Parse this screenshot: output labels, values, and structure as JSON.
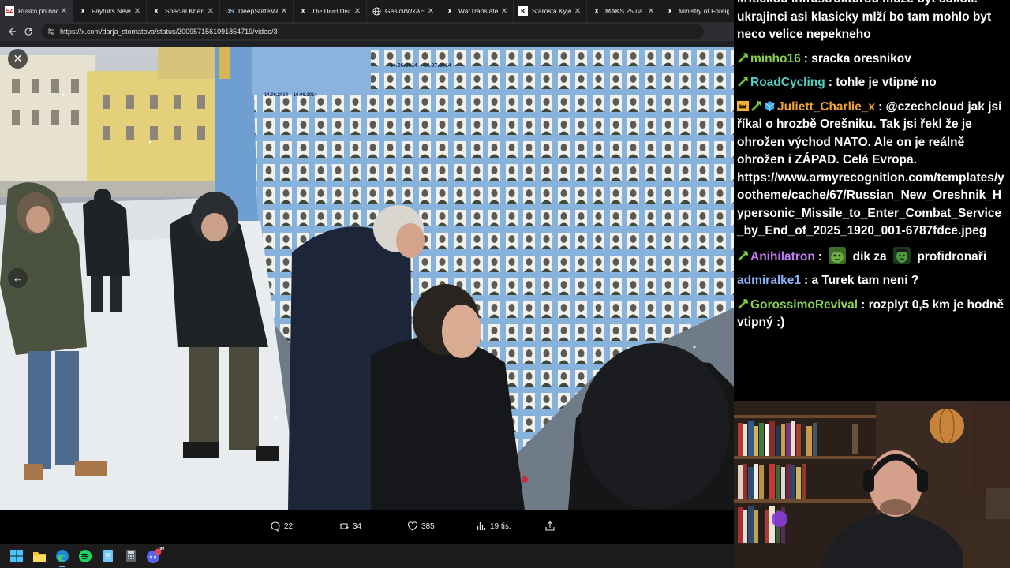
{
  "tabs": [
    {
      "label": "Rusko při noční",
      "favicon": "SZ"
    },
    {
      "label": "Faytuks News",
      "favicon": "X"
    },
    {
      "label": "Special Kherson",
      "favicon": "X"
    },
    {
      "label": "DeepStateMAP",
      "favicon": "DS"
    },
    {
      "label": "The Dead District",
      "favicon": "X"
    },
    {
      "label": "GeslcirWkAEzRc",
      "favicon": "globe"
    },
    {
      "label": "WarTranslated",
      "favicon": "X"
    },
    {
      "label": "Starosta Kyjeva",
      "favicon": "K"
    },
    {
      "label": "MAKS 25 ua",
      "favicon": "X"
    },
    {
      "label": "Ministry of Foreign",
      "favicon": "X"
    }
  ],
  "address": {
    "url": "https://x.com/darja_stomatova/status/2009571561091854719/video/3"
  },
  "video": {
    "close_icon": "close-icon",
    "prev_icon": "arrow-left-icon",
    "wall_dates": [
      "14.06.2014 – 10.07.2014",
      "14.06.2014 – 16.06.2014"
    ]
  },
  "tweet_actions": {
    "replies": "22",
    "reposts": "34",
    "likes": "385",
    "views": "19 tis."
  },
  "taskbar": {
    "icons": [
      "windows-start-icon",
      "file-explorer-icon",
      "edge-browser-icon",
      "spotify-icon",
      "notepad-icon",
      "calculator-icon",
      "discord-icon"
    ],
    "discord_badge": "99"
  },
  "chat": {
    "messages": [
      {
        "user": "",
        "color": "#ffffff",
        "badges": [],
        "text": "kritickou infrastrukturou může být cokoli. ukrajinci asi klasicky mlží bo tam mohlo byt neco velice nepekneho"
      },
      {
        "user": "minho16",
        "color": "#8bd14f",
        "badges": [
          "pickaxe"
        ],
        "text": "sracka oresnikov"
      },
      {
        "user": "RoadCycling",
        "color": "#4fd1c5",
        "badges": [
          "pickaxe"
        ],
        "text": "tohle je vtipné no"
      },
      {
        "user": "Juliett_Charlie_x",
        "color": "#f2a33a",
        "badges": [
          "crown",
          "pickaxe",
          "cube"
        ],
        "text": "@czechcloud jak jsi říkal o hrozbě Orešniku. Tak jsi řekl že je ohrožen východ NATO. Ale on je reálně ohrožen i ZÁPAD. Celá Evropa. https://www.armyrecognition.com/templates/yootheme/cache/67/Russian_New_Oreshnik_Hypersonic_Missile_to_Enter_Combat_Service_by_End_of_2025_1920_001-6787fdce.jpeg"
      },
      {
        "user": "Anihilatron",
        "color": "#c07cf2",
        "badges": [
          "pickaxe"
        ],
        "text_before": "dik za",
        "text_middle": "profidronaři",
        "emotes": [
          "green-face-emote",
          "hulk-emote"
        ]
      },
      {
        "user": "admiralke1",
        "color": "#8ab4f8",
        "badges": [],
        "text": "a Turek tam neni ?"
      },
      {
        "user": "GorossimoRevival",
        "color": "#8bd14f",
        "badges": [
          "pickaxe"
        ],
        "text": "rozplyt 0,5 km je hodně vtipný :)"
      }
    ]
  },
  "colors": {
    "chat_bg": "#000000",
    "memorial_wall": "#8fb6dc",
    "snow": "#e9ecef"
  }
}
